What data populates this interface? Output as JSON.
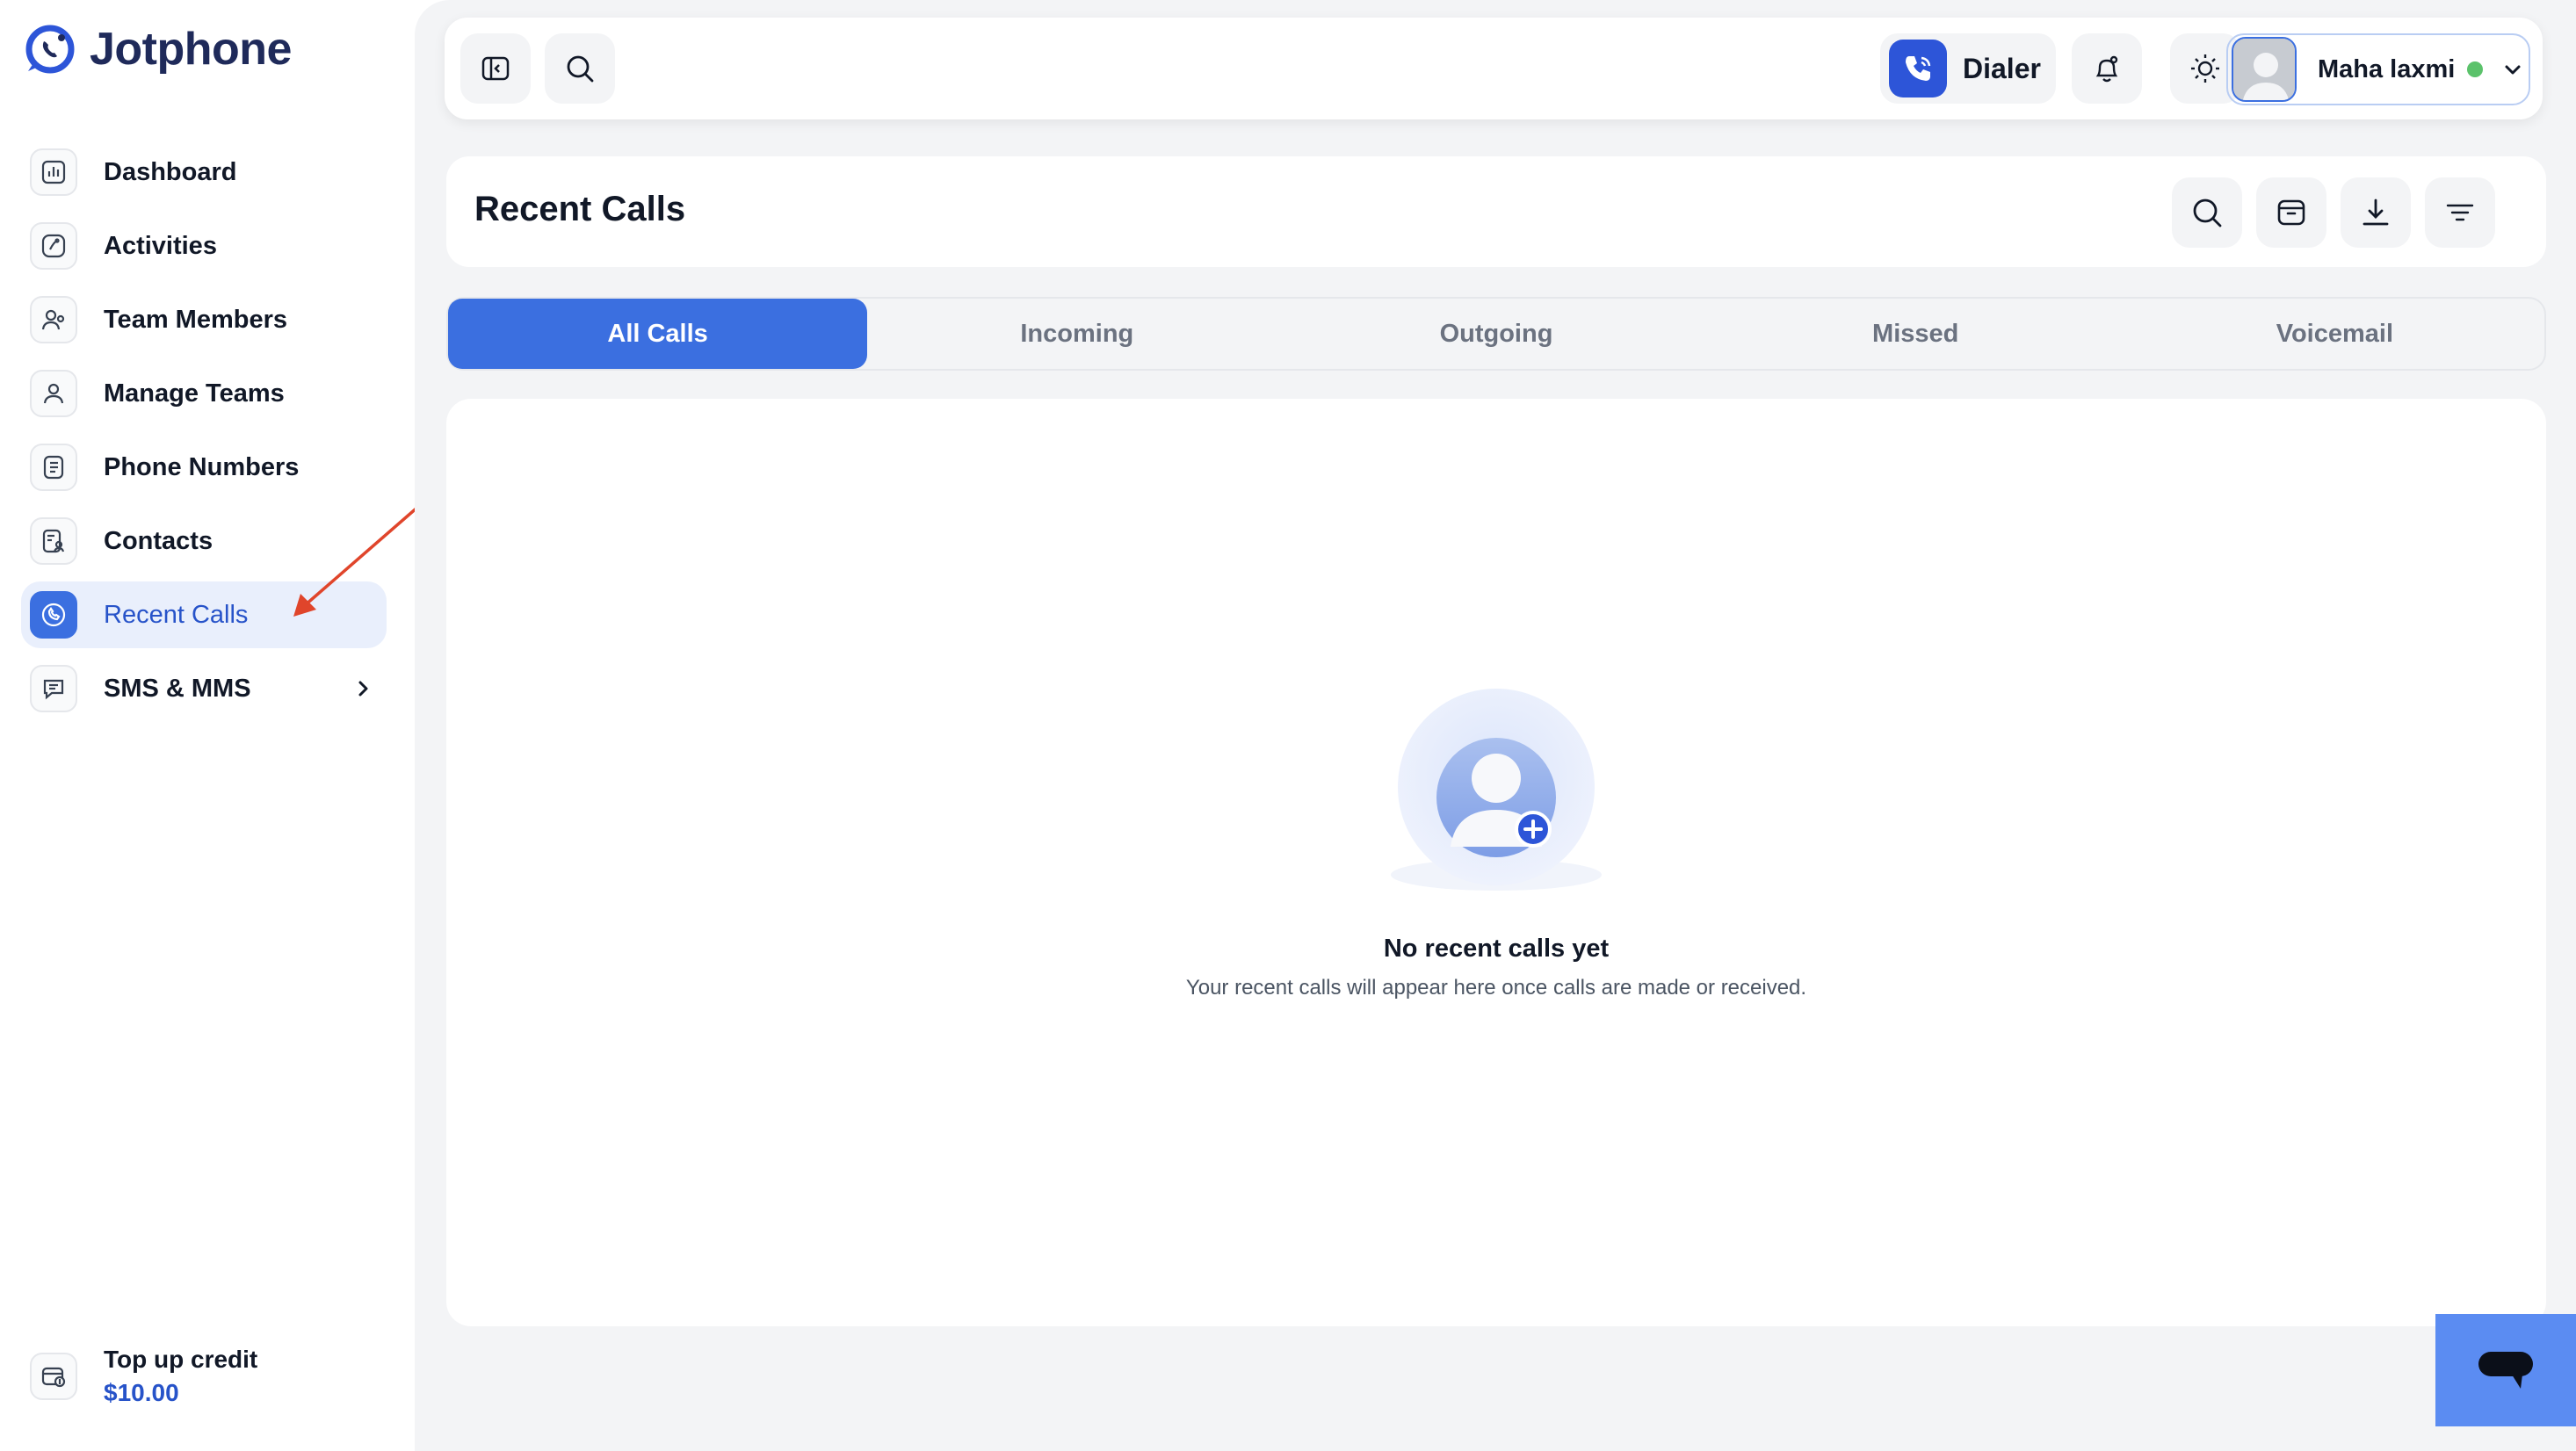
{
  "app": {
    "name": "Jotphone"
  },
  "sidebar": {
    "items": [
      {
        "label": "Dashboard",
        "icon": "chart-bars-icon",
        "active": false
      },
      {
        "label": "Activities",
        "icon": "activity-icon",
        "active": false
      },
      {
        "label": "Team Members",
        "icon": "user-group-icon",
        "active": false
      },
      {
        "label": "Manage Teams",
        "icon": "users-icon",
        "active": false
      },
      {
        "label": "Phone Numbers",
        "icon": "phone-book-icon",
        "active": false
      },
      {
        "label": "Contacts",
        "icon": "contact-card-icon",
        "active": false
      },
      {
        "label": "Recent Calls",
        "icon": "phone-history-icon",
        "active": true
      },
      {
        "label": "SMS & MMS",
        "icon": "message-icon",
        "active": false,
        "has_submenu": true
      }
    ],
    "topup": {
      "label": "Top up credit",
      "amount": "$10.00"
    }
  },
  "topbar": {
    "dialer_label": "Dialer",
    "user": {
      "name": "Maha laxmi",
      "status": "online"
    }
  },
  "page": {
    "title": "Recent Calls",
    "tabs": [
      {
        "label": "All Calls",
        "active": true
      },
      {
        "label": "Incoming",
        "active": false
      },
      {
        "label": "Outgoing",
        "active": false
      },
      {
        "label": "Missed",
        "active": false
      },
      {
        "label": "Voicemail",
        "active": false
      }
    ],
    "empty_state": {
      "title": "No recent calls yet",
      "subtitle": "Your recent calls will appear here once calls are made or received."
    }
  },
  "colors": {
    "accent": "#3b6fe0",
    "accent_text": "#2753c9",
    "status_online": "#5bc26b",
    "annotation_arrow": "#e0452b",
    "chat_button": "#5b8cf2"
  }
}
